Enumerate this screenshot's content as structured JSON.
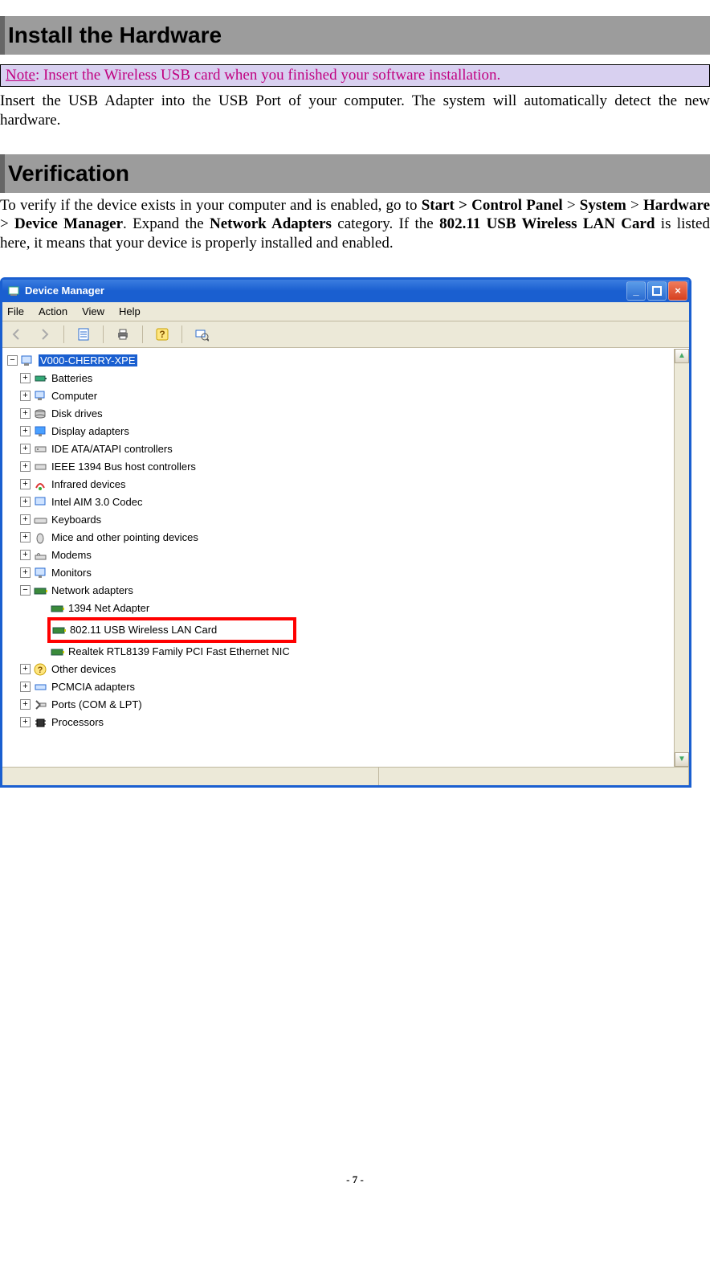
{
  "sections": {
    "install_hw_title": "Install the Hardware",
    "verification_title": "Verification"
  },
  "note": {
    "label": "Note",
    "text": ": Insert the Wireless USB card when you finished your software installation."
  },
  "install_text": "Insert the USB Adapter into the USB Port of your computer. The system will automatically detect the new hardware.",
  "verify_text": {
    "pre": "To verify if the device exists in your computer and is enabled, go to ",
    "b1": "Start >",
    "sp1": "    ",
    "b2": "Control Panel",
    "gt1": " > ",
    "b3": "System",
    "gt2": " > ",
    "b4": "Hardware",
    "gt3": " > ",
    "b5": "Device Manager",
    "mid": ". Expand the ",
    "b6": "Network Adapters",
    "mid2": " category. If the ",
    "b7": "802.11 USB Wireless LAN Card",
    "post": " is listed here, it means that your device is properly installed and enabled."
  },
  "dm": {
    "title": "Device Manager",
    "menu": {
      "file": "File",
      "action": "Action",
      "view": "View",
      "help": "Help"
    },
    "root": "V000-CHERRY-XPE",
    "nodes": {
      "batteries": "Batteries",
      "computer": "Computer",
      "disk": "Disk drives",
      "display": "Display adapters",
      "ide": "IDE ATA/ATAPI controllers",
      "ieee": "IEEE 1394 Bus host controllers",
      "infrared": "Infrared devices",
      "intelaim": "Intel AIM 3.0 Codec",
      "keyboards": "Keyboards",
      "mice": "Mice and other pointing devices",
      "modems": "Modems",
      "monitors": "Monitors",
      "netadapters": "Network adapters",
      "net_1394": "1394 Net Adapter",
      "net_usb": "802.11 USB Wireless LAN Card",
      "net_realtek": "Realtek RTL8139 Family PCI Fast Ethernet NIC",
      "other": "Other devices",
      "pcmcia": "PCMCIA adapters",
      "ports": "Ports (COM & LPT)",
      "processors": "Processors"
    }
  },
  "footer": "- 7 -"
}
